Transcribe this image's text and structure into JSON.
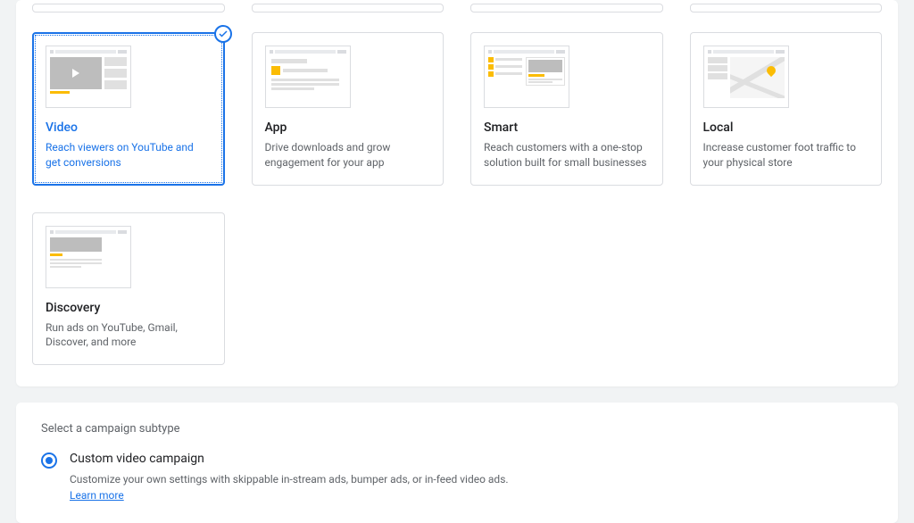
{
  "cards": {
    "video": {
      "title": "Video",
      "desc": "Reach viewers on YouTube and get conversions"
    },
    "app": {
      "title": "App",
      "desc": "Drive downloads and grow engagement for your app"
    },
    "smart": {
      "title": "Smart",
      "desc": "Reach customers with a one-stop solution built for small businesses"
    },
    "local": {
      "title": "Local",
      "desc": "Increase customer foot traffic to your physical store"
    },
    "discovery": {
      "title": "Discovery",
      "desc": "Run ads on YouTube, Gmail, Discover, and more"
    }
  },
  "subtype": {
    "heading": "Select a campaign subtype",
    "options": {
      "custom": {
        "title": "Custom video campaign",
        "desc": "Customize your own settings with skippable in-stream ads, bumper ads, or in-feed video ads. ",
        "learn_more": "Learn more"
      }
    }
  }
}
